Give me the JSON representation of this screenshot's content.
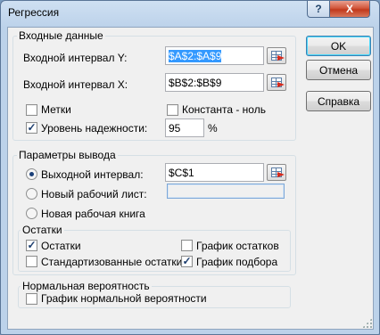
{
  "window": {
    "title": "Регрессия",
    "help_glyph": "?",
    "close_glyph": "X"
  },
  "input": {
    "group_title": "Входные данные",
    "y_range": {
      "label": "Входной интервал Y:",
      "value": "$A$2:$A$9"
    },
    "x_range": {
      "label": "Входной интервал X:",
      "value": "$B$2:$B$9"
    },
    "labels": {
      "label": "Метки",
      "checked": false
    },
    "constant_zero": {
      "label": "Константа - ноль",
      "checked": false
    },
    "confidence": {
      "label": "Уровень надежности:",
      "checked": true,
      "value": "95",
      "unit": "%"
    }
  },
  "output": {
    "group_title": "Параметры вывода",
    "output_range": {
      "label": "Выходной интервал:",
      "value": "$C$1",
      "selected": true
    },
    "new_sheet": {
      "label": "Новый рабочий лист:",
      "value": "",
      "selected": false
    },
    "new_workbook": {
      "label": "Новая рабочая книга",
      "selected": false
    }
  },
  "residuals": {
    "group_title": "Остатки",
    "residuals": {
      "label": "Остатки",
      "checked": true
    },
    "standardized": {
      "label": "Стандартизованные остатки",
      "checked": false
    },
    "residual_plots": {
      "label": "График остатков",
      "checked": false
    },
    "line_fit_plots": {
      "label": "График подбора",
      "checked": true
    }
  },
  "normal_probability": {
    "group_title": "Нормальная вероятность",
    "normal_plot": {
      "label": "График нормальной вероятности",
      "checked": false
    }
  },
  "buttons": {
    "ok": "OK",
    "cancel": "Отмена",
    "help": "Справка"
  },
  "icons": {
    "checkmark": "✓",
    "ref_button": "range-select-icon"
  },
  "colors": {
    "selection": "#3399ff",
    "close": "#c1391c",
    "frame": "#bcd2ea"
  }
}
